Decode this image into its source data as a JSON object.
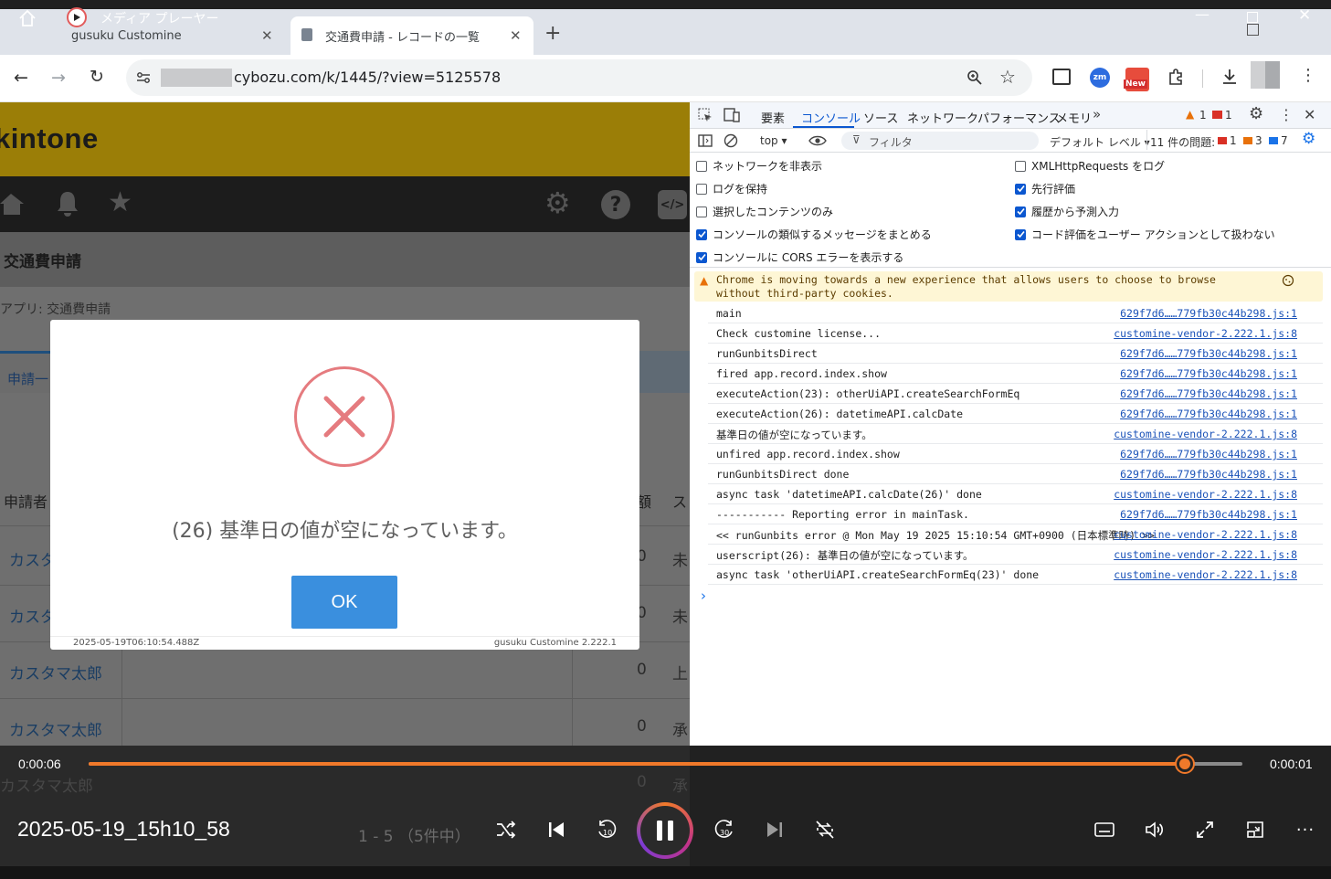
{
  "player": {
    "window_title": "メディア プレーヤー",
    "media_title": "2025-05-19_15h10_58",
    "time_current": "0:00:06",
    "time_end": "0:00:01",
    "progress": 0.95
  },
  "browser": {
    "tabs": [
      {
        "label": "gusuku Customine",
        "active": false
      },
      {
        "label": "交通費申請 - レコードの一覧",
        "active": true
      }
    ],
    "url": "cybozu.com/k/1445/?view=5125578",
    "ext_badge_new": "New",
    "ext_zm": "zm"
  },
  "kintone": {
    "logo": "kintone",
    "app_title": "交通費申請",
    "breadcrumb": "アプリ: 交通費申請",
    "view_tab": "申請一",
    "column_applicant": "申請者",
    "column_amount": "額",
    "column_status": "ス",
    "rows": [
      {
        "name": "カスタ",
        "amount": "0",
        "status": "未"
      },
      {
        "name": "カスタ",
        "amount": "0",
        "status": "未"
      },
      {
        "name": "カスタマ太郎",
        "amount": "0",
        "status": "上"
      },
      {
        "name": "カスタマ太郎",
        "amount": "0",
        "status": "承"
      },
      {
        "name": "カスタマ太郎",
        "amount": "0",
        "status": "承"
      }
    ],
    "pager": "1 - 5 （5件中）"
  },
  "modal": {
    "message": "(26) 基準日の値が空になっています。",
    "ok_label": "OK",
    "timestamp": "2025-05-19T06:10:54.488Z",
    "version": "gusuku Customine 2.222.1"
  },
  "devtools": {
    "tabs": [
      "要素",
      "コンソール",
      "ソース",
      "ネットワーク",
      "パフォーマンス",
      "メモリ"
    ],
    "warn_count": "1",
    "error_count": "1",
    "context": "top",
    "filter_placeholder": "フィルタ",
    "level": "デフォルト レベル",
    "issues_label": "11 件の問題:",
    "issues_err": "1",
    "issues_warn": "3",
    "issues_info": "7",
    "options_left": [
      {
        "label": "ネットワークを非表示",
        "checked": false
      },
      {
        "label": "ログを保持",
        "checked": false
      },
      {
        "label": "選択したコンテンツのみ",
        "checked": false
      },
      {
        "label": "コンソールの類似するメッセージをまとめる",
        "checked": true
      },
      {
        "label": "コンソールに CORS エラーを表示する",
        "checked": true
      }
    ],
    "options_right": [
      {
        "label": "XMLHttpRequests をログ",
        "checked": false
      },
      {
        "label": "先行評価",
        "checked": true
      },
      {
        "label": "履歴から予測入力",
        "checked": true
      },
      {
        "label": "コード評価をユーザー アクションとして扱わない",
        "checked": true
      }
    ],
    "warning": "Chrome is moving towards a new experience that allows users to choose to browse without third-party cookies.",
    "logs": [
      {
        "msg": "main",
        "src": "629f7d6……779fb30c44b298.js:1"
      },
      {
        "msg": "Check customine license...",
        "src": "customine-vendor-2.222.1.js:8"
      },
      {
        "msg": "runGunbitsDirect",
        "src": "629f7d6……779fb30c44b298.js:1"
      },
      {
        "msg": "fired app.record.index.show",
        "src": "629f7d6……779fb30c44b298.js:1"
      },
      {
        "msg": "executeAction(23): otherUiAPI.createSearchFormEq",
        "src": "629f7d6……779fb30c44b298.js:1"
      },
      {
        "msg": "executeAction(26): datetimeAPI.calcDate",
        "src": "629f7d6……779fb30c44b298.js:1"
      },
      {
        "msg": "基準日の値が空になっています。",
        "src": "customine-vendor-2.222.1.js:8"
      },
      {
        "msg": "unfired app.record.index.show",
        "src": "629f7d6……779fb30c44b298.js:1"
      },
      {
        "msg": "runGunbitsDirect done",
        "src": "629f7d6……779fb30c44b298.js:1"
      },
      {
        "msg": "async task 'datetimeAPI.calcDate(26)' done",
        "src": "customine-vendor-2.222.1.js:8"
      },
      {
        "msg": "----------- Reporting error in mainTask.",
        "src": "629f7d6……779fb30c44b298.js:1"
      },
      {
        "msg": "<< runGunbits error @ Mon May 19 2025 15:10:54 GMT+0900 (日本標準時) >>",
        "src": "customine-vendor-2.222.1.js:8"
      },
      {
        "msg": "userscript(26): 基準日の値が空になっています。",
        "src": "customine-vendor-2.222.1.js:8"
      },
      {
        "msg": "async task 'otherUiAPI.createSearchFormEq(23)' done",
        "src": "customine-vendor-2.222.1.js:8"
      }
    ],
    "prompt": "›"
  },
  "colors": {
    "accent": "#f0792a",
    "kintone_header": "#9b7e07",
    "ok_button": "#3a8fde",
    "error_ring": "#e57b7f",
    "devtools_blue": "#0b57d0"
  }
}
